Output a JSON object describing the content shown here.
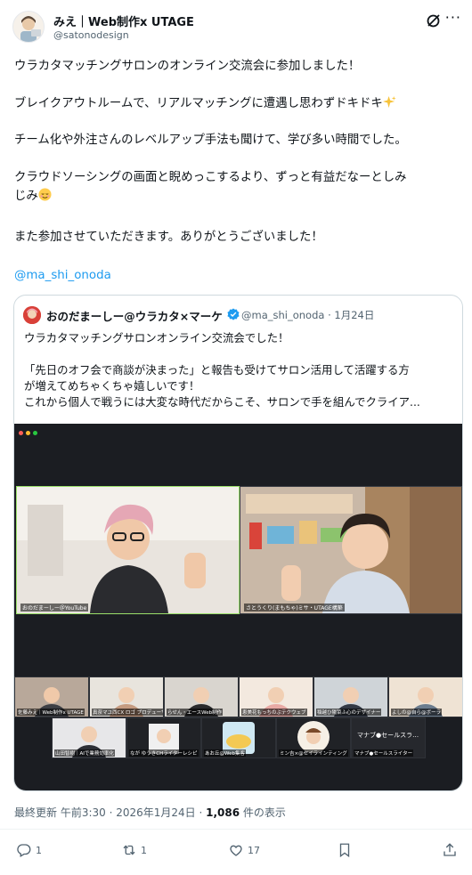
{
  "author": {
    "name": "みえ｜Web制作x UTAGE",
    "handle": "@satonodesign"
  },
  "tweet": {
    "lines": [
      "ウラカタマッチングサロンのオンライン交流会に参加しました！",
      "ブレイクアウトルームで、リアルマッチングに遭遇し思わずドキドキ",
      "チーム化や外注さんのレベルアップ手法も聞けて、学び多い時間でした。",
      "クラウドソーシングの画面と睨めっこするより、ずっと有益だなーとしみ",
      "じみ",
      "また参加させていただきます。ありがとうございました！"
    ],
    "mention": "@ma_shi_onoda"
  },
  "quote": {
    "name": "おのだまーしー@ウラカタ×マーケ",
    "handle": "@ma_shi_onoda",
    "sep": "·",
    "date": "1月24日",
    "lines": [
      "ウラカタマッチングサロンオンライン交流会でした！",
      "「先日のオフ会で商談が決まった」と報告も受けてサロン活用して活躍する方",
      "が増えてめちゃくちゃ嬉しいです！",
      "これから個人で戦うには大変な時代だからこそ、サロンで手を組んでクライア..."
    ],
    "video": {
      "main_labels": [
        "おのだまーしー＠YouTube",
        "さとうくり(まもちゃ)ミサ・UTAGE構築"
      ],
      "participants": [
        "佐藤みえ｜Web制作x UTAGE",
        "真奈マユ西CX ロゴ プロデューサー",
        "らせん・エースWeb制作",
        "恵美花もっちのぶテクウェブ",
        "稲越ひ陽菜ふ心のデザイナー",
        "よしの@自ら@ボーラ",
        "山田智樹｜AIで業務効率化",
        "なが ゆうきCHライターレシピ",
        "あお丘@Web集客",
        "ミン吉×@セイラインティング",
        "マナブ●セールスライター"
      ],
      "overflow_label": "マナブ●セールスラ…"
    }
  },
  "footer": {
    "prefix": "最終更新 ",
    "time": "午前3:30",
    "sep1": " · ",
    "date": "2026年1月24日",
    "sep2": " · ",
    "views": "1,086",
    "views_suffix": " 件の表示"
  },
  "actions": {
    "replies": "1",
    "reposts": "1",
    "likes": "17"
  },
  "colors": {
    "accent": "#1d9bf0",
    "muted": "#536471",
    "verified": "#1d9bf0",
    "video_bg": "#1b1d22",
    "window_dots": [
      "#ff5f57",
      "#febc2e",
      "#28c840"
    ]
  },
  "icons": [
    "grok-icon",
    "more-icon",
    "verified-badge-icon",
    "sparkles-icon",
    "relieved-face-icon",
    "reply-icon",
    "repost-icon",
    "like-icon",
    "bookmark-icon",
    "share-icon"
  ]
}
